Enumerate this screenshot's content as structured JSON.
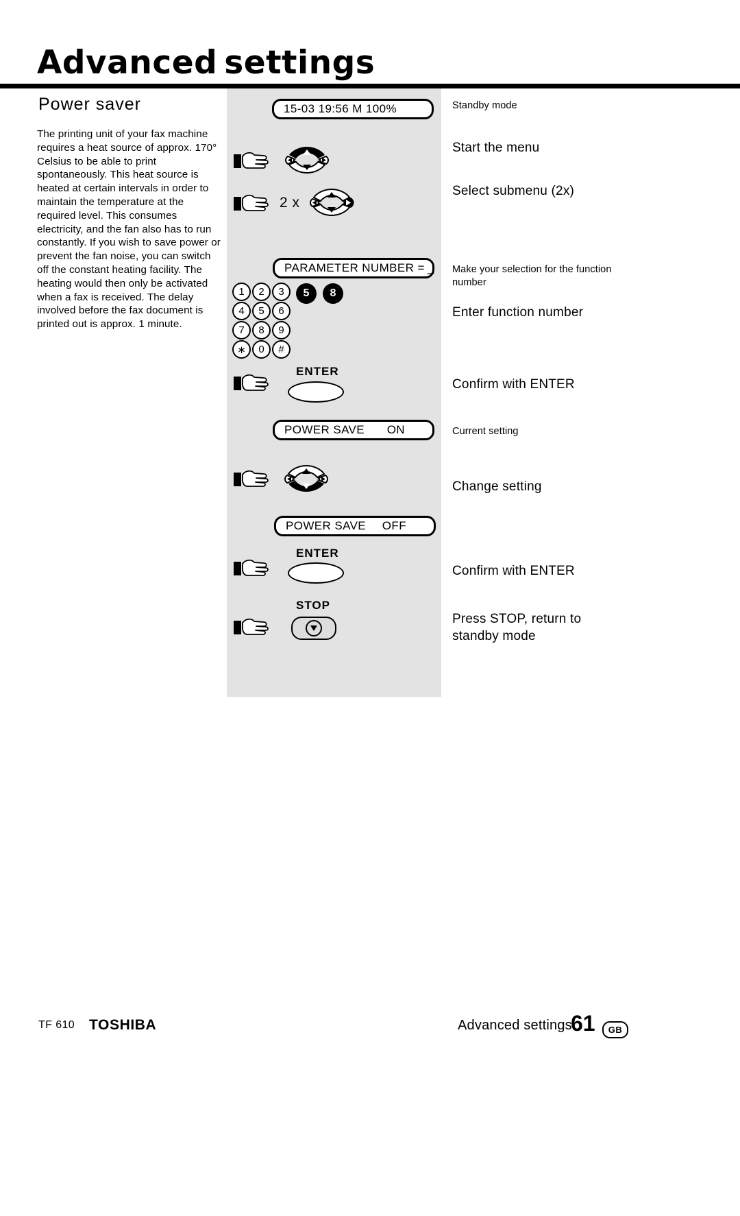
{
  "header": {
    "title_part1": "Advanced",
    "title_part2": "settings"
  },
  "left": {
    "section_title": "Power saver",
    "body": "The printing unit of your fax machine requires a heat source of approx. 170° Celsius to be able to print spontaneously. This heat source is heated at certain intervals in order to maintain the temperature at the required level. This consumes electricity, and the fan also has to run constantly. If you wish to save power or prevent the fan noise, you can switch off the constant heating facility. The heating would then only be activated when a fax is received. The delay involved before the fax document is printed out is approx. 1 minute."
  },
  "panel": {
    "lcd_standby": "15-03 19:56  M 100%",
    "lcd_parameter_label": "PARAMETER NUMBER =",
    "lcd_parameter_cursor": "_",
    "lcd_power_save_on_label": "POWER SAVE",
    "lcd_power_save_on_value": "ON",
    "lcd_power_save_off_label": "POWER SAVE",
    "lcd_power_save_off_value": "OFF",
    "repeat_count": "2 x",
    "keypad_rows": [
      [
        "1",
        "2",
        "3"
      ],
      [
        "4",
        "5",
        "6"
      ],
      [
        "7",
        "8",
        "9"
      ],
      [
        "∗",
        "0",
        "#"
      ]
    ],
    "highlighted_keys": [
      "5",
      "8"
    ],
    "enter_label_1": "ENTER",
    "enter_label_2": "ENTER",
    "stop_label": "STOP"
  },
  "right": {
    "standby_mode": "Standby mode",
    "start_menu": "Start the menu",
    "select_submenu": "Select submenu (2x)",
    "make_selection": "Make your selection for the function number",
    "enter_function_number": "Enter function number",
    "confirm_enter_1": "Confirm with ENTER",
    "current_setting": "Current setting",
    "change_setting": "Change setting",
    "confirm_enter_2": "Confirm with ENTER",
    "press_stop": "Press STOP, return to standby mode"
  },
  "footer": {
    "model": "TF 610",
    "brand": "TOSHIBA",
    "section": "Advanced settings",
    "page_number": "61",
    "language": "GB"
  }
}
